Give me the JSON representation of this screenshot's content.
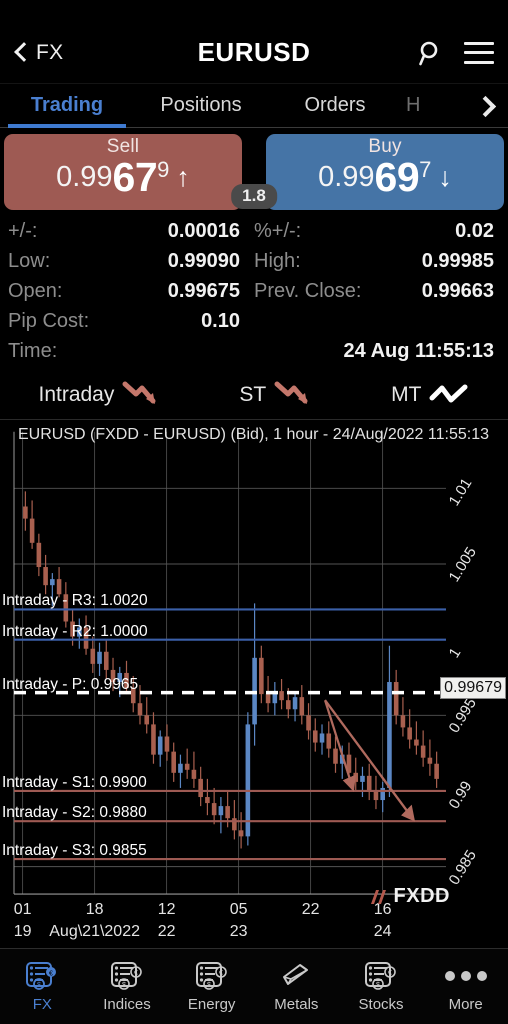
{
  "header": {
    "back_label": "FX",
    "title": "EURUSD",
    "search_icon": "search-icon",
    "menu_icon": "hamburger-menu-icon"
  },
  "tabs": {
    "items": [
      {
        "label": "Trading",
        "active": true
      },
      {
        "label": "Positions",
        "active": false
      },
      {
        "label": "Orders",
        "active": false
      },
      {
        "label": "H",
        "active": false
      }
    ],
    "next_icon": "chevron-right-icon"
  },
  "quotes": {
    "sell": {
      "label": "Sell",
      "price_small": "0.99",
      "price_big": "67",
      "price_frac": "9",
      "direction": "up",
      "arrow": "↑",
      "color": "#9e5a53"
    },
    "buy": {
      "label": "Buy",
      "price_small": "0.99",
      "price_big": "69",
      "price_frac": "7",
      "direction": "down",
      "arrow": "↓",
      "color": "#4574a6"
    },
    "spread": "1.8"
  },
  "stats": {
    "rows": [
      [
        {
          "key": "+/-:",
          "value": "0.00016"
        },
        {
          "key": "%+/-:",
          "value": "0.02"
        }
      ],
      [
        {
          "key": "Low:",
          "value": "0.99090"
        },
        {
          "key": "High:",
          "value": "0.99985"
        }
      ],
      [
        {
          "key": "Open:",
          "value": "0.99675"
        },
        {
          "key": "Prev. Close:",
          "value": "0.99663"
        }
      ],
      [
        {
          "key": "Pip Cost:",
          "value": "0.10"
        },
        {
          "key": "",
          "value": ""
        }
      ],
      [
        {
          "key": "Time:",
          "value": "24 Aug 11:55:13"
        }
      ]
    ]
  },
  "trends": [
    {
      "label": "Intraday",
      "direction": "down",
      "color": "#c4776b"
    },
    {
      "label": "ST",
      "direction": "down",
      "color": "#c4776b"
    },
    {
      "label": "MT",
      "direction": "flat",
      "color": "#ffffff"
    }
  ],
  "chart_data": {
    "type": "line",
    "title": "EURUSD (FXDD - EURUSD) (Bid), 1 hour - 24/Aug/2022 11:55:13",
    "symbol": "EURUSD",
    "broker": "FXDD",
    "quote_side": "Bid",
    "timeframe": "1 hour",
    "as_of": "24/Aug/2022 11:55:13",
    "xlabel": "",
    "ylabel": "",
    "ylim": [
      0.9835,
      1.0125
    ],
    "grid": true,
    "legend": "none",
    "y_ticks": [
      "1.01",
      "1.005",
      "1",
      "0.995",
      "0.99",
      "0.985"
    ],
    "y_tick_values": [
      1.01,
      1.005,
      1.0,
      0.995,
      0.99,
      0.985
    ],
    "x_ticks": [
      {
        "top": "01",
        "bottom": "19"
      },
      {
        "top": "18",
        "bottom": "Aug\\21\\2022"
      },
      {
        "top": "12",
        "bottom": "22"
      },
      {
        "top": "05",
        "bottom": "23"
      },
      {
        "top": "22",
        "bottom": ""
      },
      {
        "top": "16",
        "bottom": "24"
      }
    ],
    "current_price_tag": "0.99679",
    "current_price": 0.99679,
    "levels": [
      {
        "name": "Intraday - R3",
        "value": "1.0020",
        "num": 1.002,
        "color": "#3b5fa8",
        "style": "solid"
      },
      {
        "name": "Intraday - R2",
        "value": "1.0000",
        "num": 1.0,
        "color": "#3b5fa8",
        "style": "solid"
      },
      {
        "name": "Intraday - P",
        "value": "0.9965",
        "num": 0.9965,
        "color": "#ffffff",
        "style": "dashed"
      },
      {
        "name": "Intraday - S1",
        "value": "0.9900",
        "num": 0.99,
        "color": "#9e5a53",
        "style": "solid"
      },
      {
        "name": "Intraday - S2",
        "value": "0.9880",
        "num": 0.988,
        "color": "#9e5a53",
        "style": "solid"
      },
      {
        "name": "Intraday - S3",
        "value": "0.9855",
        "num": 0.9855,
        "color": "#9e5a53",
        "style": "solid"
      }
    ],
    "candles": [
      [
        1.0088,
        1.0098,
        1.0072,
        1.008
      ],
      [
        1.008,
        1.0092,
        1.006,
        1.0064
      ],
      [
        1.0064,
        1.007,
        1.0042,
        1.0048
      ],
      [
        1.0048,
        1.0056,
        1.003,
        1.0036
      ],
      [
        1.0036,
        1.0044,
        1.0022,
        1.004
      ],
      [
        1.004,
        1.0048,
        1.0028,
        1.003
      ],
      [
        1.003,
        1.0038,
        1.0008,
        1.0012
      ],
      [
        1.0012,
        1.002,
        0.9996,
        1.0002
      ],
      [
        1.0002,
        1.0014,
        0.9994,
        1.0008
      ],
      [
        1.0008,
        1.0016,
        0.999,
        0.9994
      ],
      [
        0.9994,
        1.0002,
        0.9978,
        0.9984
      ],
      [
        0.9984,
        0.9998,
        0.9976,
        0.9992
      ],
      [
        0.9992,
        1.0,
        0.9974,
        0.998
      ],
      [
        0.998,
        0.9988,
        0.9966,
        0.9972
      ],
      [
        0.9972,
        0.9982,
        0.9962,
        0.9978
      ],
      [
        0.9978,
        0.9986,
        0.9964,
        0.9968
      ],
      [
        0.9968,
        0.9976,
        0.9952,
        0.9958
      ],
      [
        0.9958,
        0.997,
        0.9944,
        0.995
      ],
      [
        0.995,
        0.9962,
        0.9938,
        0.9944
      ],
      [
        0.9944,
        0.9952,
        0.9918,
        0.9924
      ],
      [
        0.9924,
        0.994,
        0.9916,
        0.9936
      ],
      [
        0.9936,
        0.9944,
        0.992,
        0.9926
      ],
      [
        0.9926,
        0.9932,
        0.9906,
        0.9912
      ],
      [
        0.9912,
        0.9924,
        0.9902,
        0.9918
      ],
      [
        0.9918,
        0.9928,
        0.9908,
        0.9914
      ],
      [
        0.9914,
        0.9926,
        0.9902,
        0.9908
      ],
      [
        0.9908,
        0.9916,
        0.989,
        0.9896
      ],
      [
        0.9896,
        0.9908,
        0.9884,
        0.9892
      ],
      [
        0.9892,
        0.9902,
        0.9878,
        0.9884
      ],
      [
        0.9884,
        0.9896,
        0.9872,
        0.989
      ],
      [
        0.989,
        0.99,
        0.9876,
        0.9882
      ],
      [
        0.9882,
        0.9894,
        0.9868,
        0.9874
      ],
      [
        0.9874,
        0.9886,
        0.9862,
        0.987
      ],
      [
        0.987,
        0.9952,
        0.9864,
        0.9944
      ],
      [
        0.9944,
        1.0024,
        0.993,
        0.9988
      ],
      [
        0.9988,
        0.9996,
        0.9958,
        0.9964
      ],
      [
        0.9964,
        0.9976,
        0.9952,
        0.9958
      ],
      [
        0.9958,
        0.9972,
        0.995,
        0.9966
      ],
      [
        0.9966,
        0.9974,
        0.9954,
        0.996
      ],
      [
        0.996,
        0.9968,
        0.9948,
        0.9954
      ],
      [
        0.9954,
        0.9966,
        0.9946,
        0.9962
      ],
      [
        0.9962,
        0.997,
        0.9944,
        0.995
      ],
      [
        0.995,
        0.9958,
        0.9934,
        0.994
      ],
      [
        0.994,
        0.9948,
        0.9926,
        0.9932
      ],
      [
        0.9932,
        0.9944,
        0.9924,
        0.9938
      ],
      [
        0.9938,
        0.9946,
        0.9922,
        0.9928
      ],
      [
        0.9928,
        0.9936,
        0.9912,
        0.9918
      ],
      [
        0.9918,
        0.993,
        0.9908,
        0.9924
      ],
      [
        0.9924,
        0.9932,
        0.9906,
        0.9912
      ],
      [
        0.9912,
        0.9922,
        0.99,
        0.9906
      ],
      [
        0.9906,
        0.9916,
        0.9896,
        0.991
      ],
      [
        0.991,
        0.9918,
        0.9894,
        0.99
      ],
      [
        0.99,
        0.991,
        0.9888,
        0.9894
      ],
      [
        0.9894,
        0.9906,
        0.9886,
        0.9902
      ],
      [
        0.9902,
        0.9996,
        0.9896,
        0.9972
      ],
      [
        0.9972,
        0.998,
        0.9944,
        0.995
      ],
      [
        0.995,
        0.9962,
        0.9936,
        0.9942
      ],
      [
        0.9942,
        0.9954,
        0.9928,
        0.9934
      ],
      [
        0.9934,
        0.9946,
        0.9924,
        0.993
      ],
      [
        0.993,
        0.994,
        0.9916,
        0.9922
      ],
      [
        0.9922,
        0.9934,
        0.991,
        0.9918
      ],
      [
        0.9918,
        0.9926,
        0.9902,
        0.9908
      ]
    ],
    "projection_arrows": [
      {
        "from": [
          0.72,
          0.996
        ],
        "to": [
          0.785,
          0.9901
        ],
        "color": "#b06a5e"
      },
      {
        "from": [
          0.72,
          0.996
        ],
        "to": [
          0.925,
          0.9881
        ],
        "color": "#b06a5e"
      }
    ],
    "watermark": "FXDD"
  },
  "bottomnav": {
    "items": [
      {
        "label": "FX",
        "icon": "fx-quotes-icon",
        "active": true
      },
      {
        "label": "Indices",
        "icon": "indices-quotes-icon",
        "active": false
      },
      {
        "label": "Energy",
        "icon": "energy-quotes-icon",
        "active": false
      },
      {
        "label": "Metals",
        "icon": "metals-bar-icon",
        "active": false
      },
      {
        "label": "Stocks",
        "icon": "stocks-quotes-icon",
        "active": false
      },
      {
        "label": "More",
        "icon": "more-dots-icon",
        "active": false
      }
    ]
  }
}
